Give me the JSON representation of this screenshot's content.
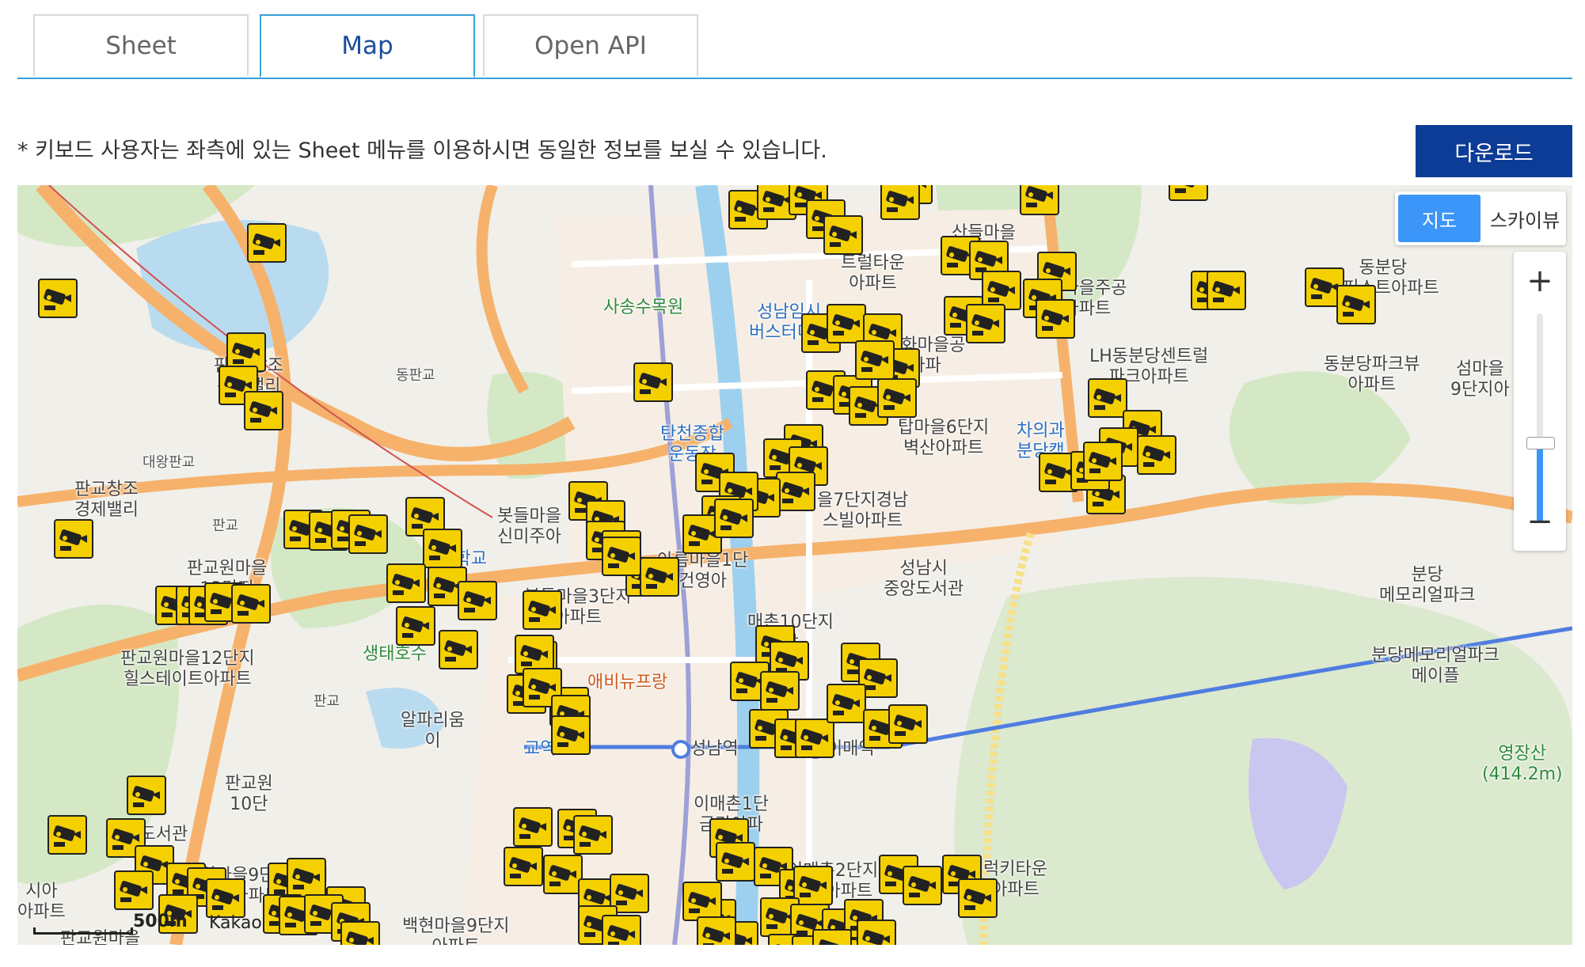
{
  "tabs": [
    {
      "label": "Sheet",
      "active": false
    },
    {
      "label": "Map",
      "active": true
    },
    {
      "label": "Open API",
      "active": false
    }
  ],
  "notice": "* 키보드 사용자는 좌측에 있는 Sheet 메뉴를 이용하시면 동일한 정보를 보실 수 있습니다.",
  "download_label": "다운로드",
  "map": {
    "map_type": {
      "map": "지도",
      "skyview": "스카이뷰",
      "selected": "지도"
    },
    "zoom_in": "+",
    "zoom_out": "−",
    "scale": "500m",
    "brand": "Kakao",
    "marker_icon": "cctv-icon",
    "colors": {
      "marker": "#f5d000",
      "accent": "#3c95f8",
      "download": "#0d3c96",
      "tab_border": "#39a0d6"
    },
    "labels": {
      "l1": "산들마을\n아파트",
      "l2": "트럴타운\n아파트",
      "l3": "사송수목원",
      "l4": "성남임시\n버스터미널",
      "l5": "판교 창조\n경제밸리",
      "l6": "동판교",
      "l7": "대왕판교",
      "l8": "판교창조\n경제밸리",
      "l9": "판교",
      "l10": "판교원마을\n13단지",
      "l11": "판교원마을12단지\n힐스테이트아파트",
      "l12": "생태호수",
      "l13": "판교",
      "l14": "봇들마을\n신미주아",
      "l15": "봇들마을3단지\n아파트",
      "l16": "탄천종합\n운동장",
      "l17": "아름마을1단\n건영아",
      "l18": "매촌10단지\n삼",
      "l19": "매화마을주공\n지아파트",
      "l20": "매화마을공\n아파",
      "l21": "탑마을6단지\n벽산아파트",
      "l22": "을7단지경남\n스빌아파트",
      "l23": "차의과\n분당캠",
      "l24": "LH동분당센트럴\n파크아파트",
      "l25": "동분당\n더퍼스트아파트",
      "l26": "동분당파크뷰\n아파트",
      "l27": "섬마을\n9단지아",
      "l28": "성남시\n중앙도서관",
      "l29": "분당\n메모리얼파크",
      "l30": "분당메모리얼파크\n메이플",
      "l31": "영장산\n(414.2m)",
      "l32": "성남역",
      "l33": "이매역",
      "l34": "알파리움\n이",
      "l35": "이매촌1단\n금강아파",
      "l36": "이매촌2단지\n한신아파트",
      "l37": "럭키타운\n아파트",
      "l38": "판교원\n10단",
      "l39": "판교도서관",
      "l40": "판교원마을9단지 한림\n풀아파트",
      "l41": "백현마을9단지\n아파트",
      "l42": "판교원마을",
      "l43": "시아\n아파트",
      "l44": "애비뉴프랑",
      "l45": "판교역",
      "l46": "판대학교\n캠",
      "l47": "교역"
    }
  }
}
